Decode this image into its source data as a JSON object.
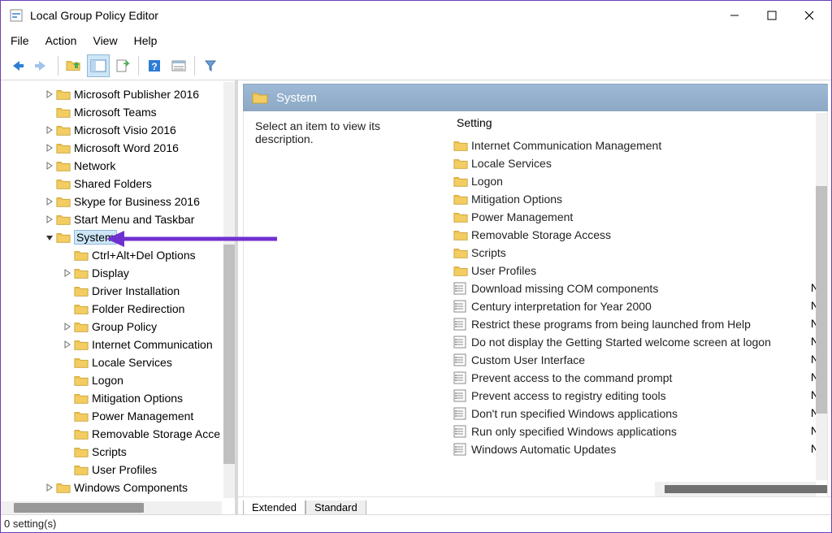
{
  "window": {
    "title": "Local Group Policy Editor"
  },
  "menus": [
    "File",
    "Action",
    "View",
    "Help"
  ],
  "tree": {
    "siblings": [
      {
        "label": "Microsoft Publisher 2016",
        "caret": ">"
      },
      {
        "label": "Microsoft Teams",
        "caret": ""
      },
      {
        "label": "Microsoft Visio 2016",
        "caret": ">"
      },
      {
        "label": "Microsoft Word 2016",
        "caret": ">"
      },
      {
        "label": "Network",
        "caret": ">"
      },
      {
        "label": "Shared Folders",
        "caret": ""
      },
      {
        "label": "Skype for Business 2016",
        "caret": ">"
      },
      {
        "label": "Start Menu and Taskbar",
        "caret": ">"
      }
    ],
    "selected": {
      "label": "System",
      "caret": "v"
    },
    "children": [
      {
        "label": "Ctrl+Alt+Del Options",
        "caret": ""
      },
      {
        "label": "Display",
        "caret": ">"
      },
      {
        "label": "Driver Installation",
        "caret": ""
      },
      {
        "label": "Folder Redirection",
        "caret": ""
      },
      {
        "label": "Group Policy",
        "caret": ">"
      },
      {
        "label": "Internet Communication",
        "caret": ">"
      },
      {
        "label": "Locale Services",
        "caret": ""
      },
      {
        "label": "Logon",
        "caret": ""
      },
      {
        "label": "Mitigation Options",
        "caret": ""
      },
      {
        "label": "Power Management",
        "caret": ""
      },
      {
        "label": "Removable Storage Acce",
        "caret": ""
      },
      {
        "label": "Scripts",
        "caret": ""
      },
      {
        "label": "User Profiles",
        "caret": ""
      }
    ],
    "after": {
      "label": "Windows Components",
      "caret": ">"
    }
  },
  "detail": {
    "header": "System",
    "description": "Select an item to view its description.",
    "column_header": "Setting",
    "folders": [
      "Internet Communication Management",
      "Locale Services",
      "Logon",
      "Mitigation Options",
      "Power Management",
      "Removable Storage Access",
      "Scripts",
      "User Profiles"
    ],
    "settings": [
      {
        "name": "Download missing COM components",
        "state": "N"
      },
      {
        "name": "Century interpretation for Year 2000",
        "state": "N"
      },
      {
        "name": "Restrict these programs from being launched from Help",
        "state": "N"
      },
      {
        "name": "Do not display the Getting Started welcome screen at logon",
        "state": "N"
      },
      {
        "name": "Custom User Interface",
        "state": "N"
      },
      {
        "name": "Prevent access to the command prompt",
        "state": "N"
      },
      {
        "name": "Prevent access to registry editing tools",
        "state": "N"
      },
      {
        "name": "Don't run specified Windows applications",
        "state": "N"
      },
      {
        "name": "Run only specified Windows applications",
        "state": "N"
      },
      {
        "name": "Windows Automatic Updates",
        "state": "N"
      }
    ]
  },
  "tabs": {
    "extended": "Extended",
    "standard": "Standard"
  },
  "status": "0 setting(s)"
}
